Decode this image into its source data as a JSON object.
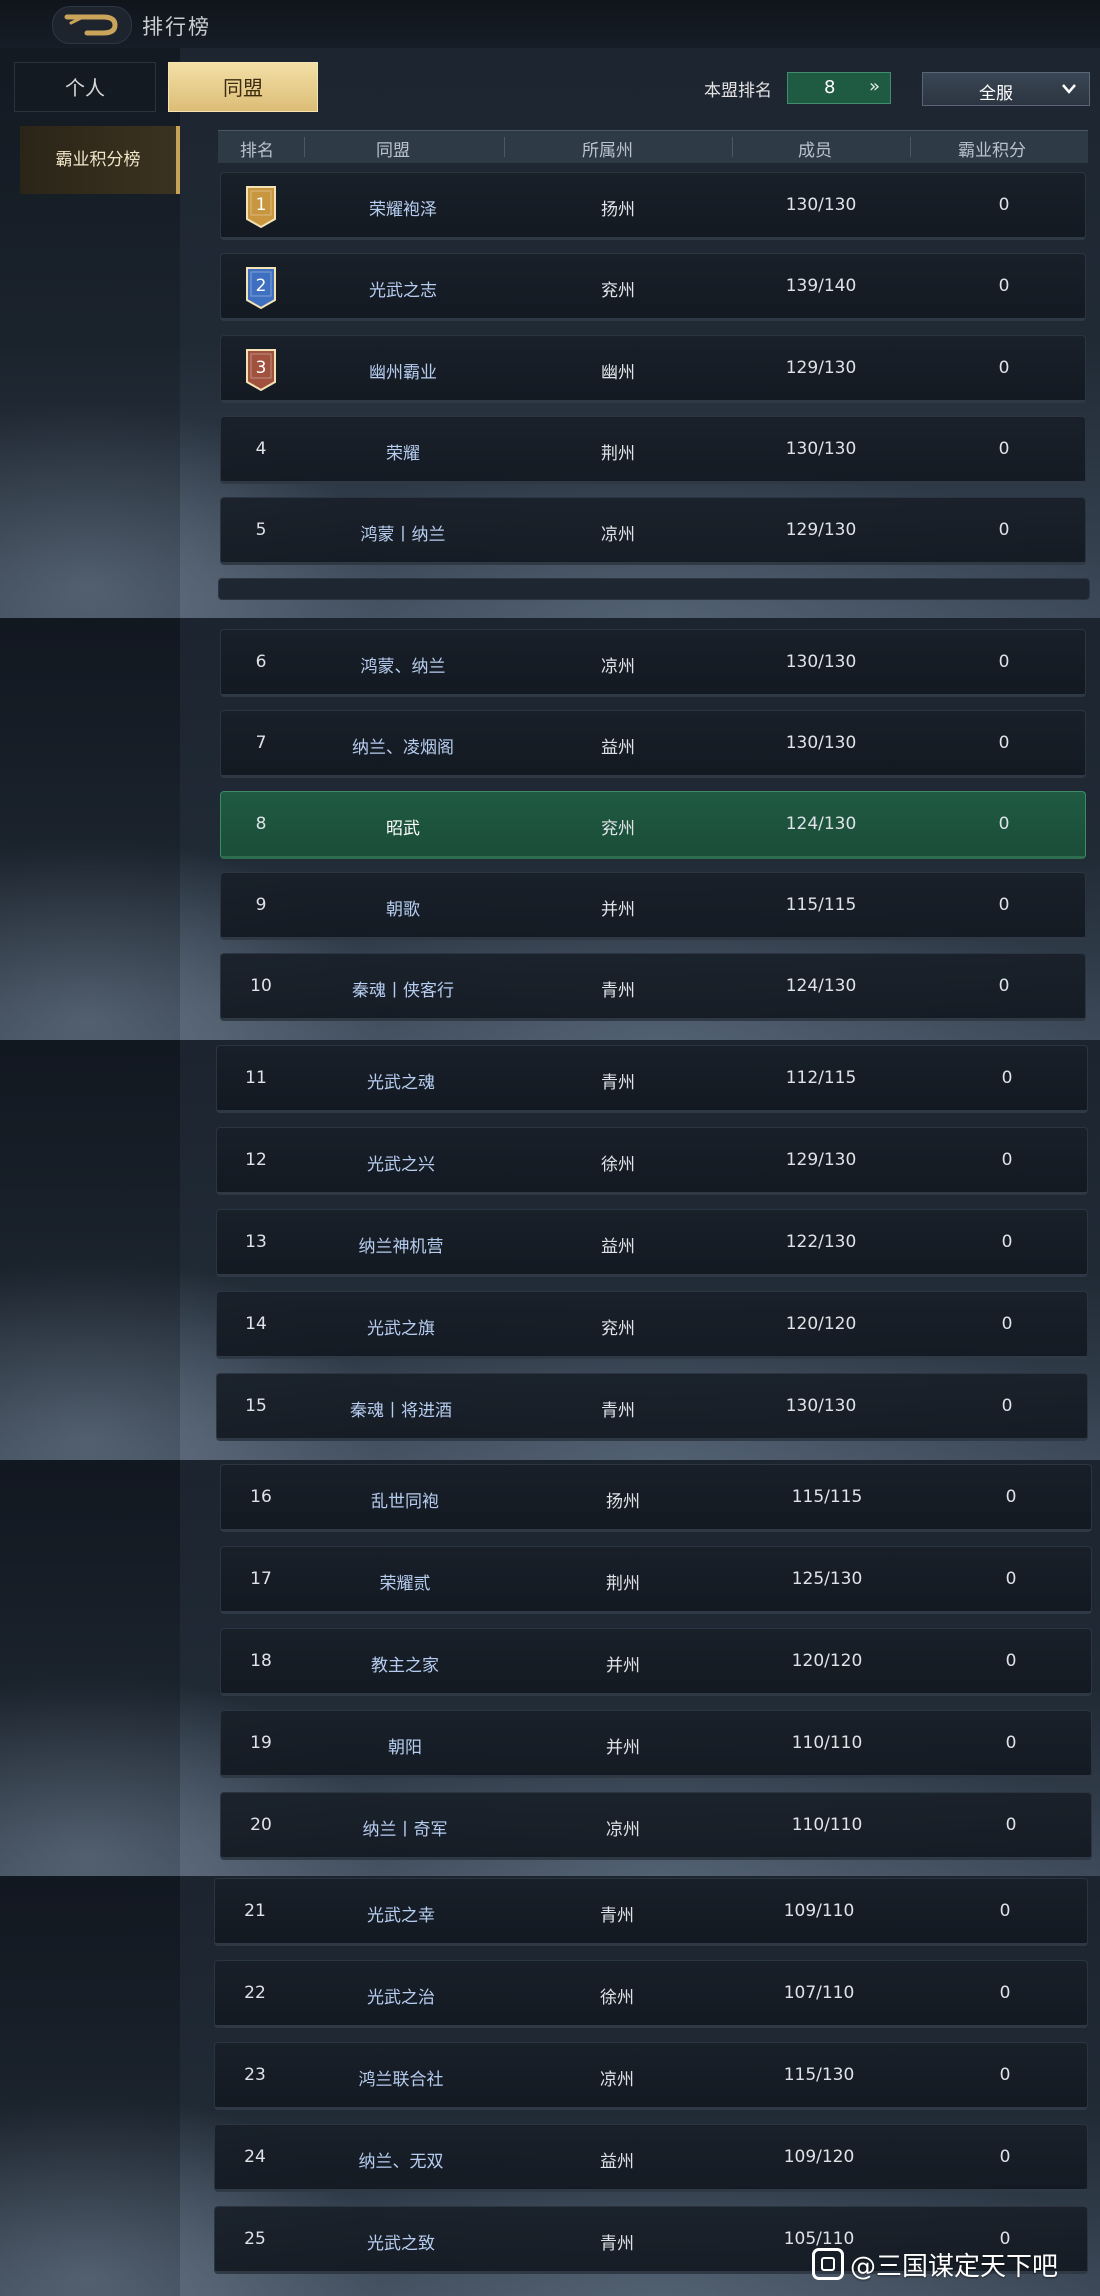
{
  "header": {
    "title": "排行榜"
  },
  "tabs": [
    {
      "label": "个人",
      "active": false
    },
    {
      "label": "同盟",
      "active": true
    }
  ],
  "my_rank": {
    "label": "本盟排名",
    "value": "8"
  },
  "server_filter": {
    "selected": "全服"
  },
  "side_tabs": [
    {
      "label": "霸业积分榜",
      "active": true
    }
  ],
  "columns": [
    "排名",
    "同盟",
    "所属州",
    "成员",
    "霸业积分"
  ],
  "rows": [
    {
      "rank": "1",
      "name": "荣耀袍泽",
      "state": "扬州",
      "members": "130/130",
      "score": "0"
    },
    {
      "rank": "2",
      "name": "光武之志",
      "state": "兖州",
      "members": "139/140",
      "score": "0"
    },
    {
      "rank": "3",
      "name": "幽州霸业",
      "state": "幽州",
      "members": "129/130",
      "score": "0"
    },
    {
      "rank": "4",
      "name": "荣耀",
      "state": "荆州",
      "members": "130/130",
      "score": "0"
    },
    {
      "rank": "5",
      "name": "鸿蒙丨纳兰",
      "state": "凉州",
      "members": "129/130",
      "score": "0"
    },
    {
      "rank": "6",
      "name": "鸿蒙、纳兰",
      "state": "凉州",
      "members": "130/130",
      "score": "0"
    },
    {
      "rank": "7",
      "name": "纳兰、凌烟阁",
      "state": "益州",
      "members": "130/130",
      "score": "0"
    },
    {
      "rank": "8",
      "name": "昭武",
      "state": "兖州",
      "members": "124/130",
      "score": "0"
    },
    {
      "rank": "9",
      "name": "朝歌",
      "state": "并州",
      "members": "115/115",
      "score": "0"
    },
    {
      "rank": "10",
      "name": "秦魂丨侠客行",
      "state": "青州",
      "members": "124/130",
      "score": "0"
    },
    {
      "rank": "11",
      "name": "光武之魂",
      "state": "青州",
      "members": "112/115",
      "score": "0"
    },
    {
      "rank": "12",
      "name": "光武之兴",
      "state": "徐州",
      "members": "129/130",
      "score": "0"
    },
    {
      "rank": "13",
      "name": "纳兰神机营",
      "state": "益州",
      "members": "122/130",
      "score": "0"
    },
    {
      "rank": "14",
      "name": "光武之旗",
      "state": "兖州",
      "members": "120/120",
      "score": "0"
    },
    {
      "rank": "15",
      "name": "秦魂丨将进酒",
      "state": "青州",
      "members": "130/130",
      "score": "0"
    },
    {
      "rank": "16",
      "name": "乱世同袍",
      "state": "扬州",
      "members": "115/115",
      "score": "0"
    },
    {
      "rank": "17",
      "name": "荣耀贰",
      "state": "荆州",
      "members": "125/130",
      "score": "0"
    },
    {
      "rank": "18",
      "name": "教主之家",
      "state": "并州",
      "members": "120/120",
      "score": "0"
    },
    {
      "rank": "19",
      "name": "朝阳",
      "state": "并州",
      "members": "110/110",
      "score": "0"
    },
    {
      "rank": "20",
      "name": "纳兰丨奇军",
      "state": "凉州",
      "members": "110/110",
      "score": "0"
    },
    {
      "rank": "21",
      "name": "光武之幸",
      "state": "青州",
      "members": "109/110",
      "score": "0"
    },
    {
      "rank": "22",
      "name": "光武之治",
      "state": "徐州",
      "members": "107/110",
      "score": "0"
    },
    {
      "rank": "23",
      "name": "鸿兰联合社",
      "state": "凉州",
      "members": "115/130",
      "score": "0"
    },
    {
      "rank": "24",
      "name": "纳兰、无双",
      "state": "益州",
      "members": "109/120",
      "score": "0"
    },
    {
      "rank": "25",
      "name": "光武之致",
      "state": "青州",
      "members": "105/110",
      "score": "0"
    }
  ],
  "highlight_rank": "8",
  "badge_colors": {
    "gold": "#c8963e",
    "blue": "#3f6fc0",
    "bronze": "#a0523e"
  },
  "watermark": "@三国谋定天下吧"
}
